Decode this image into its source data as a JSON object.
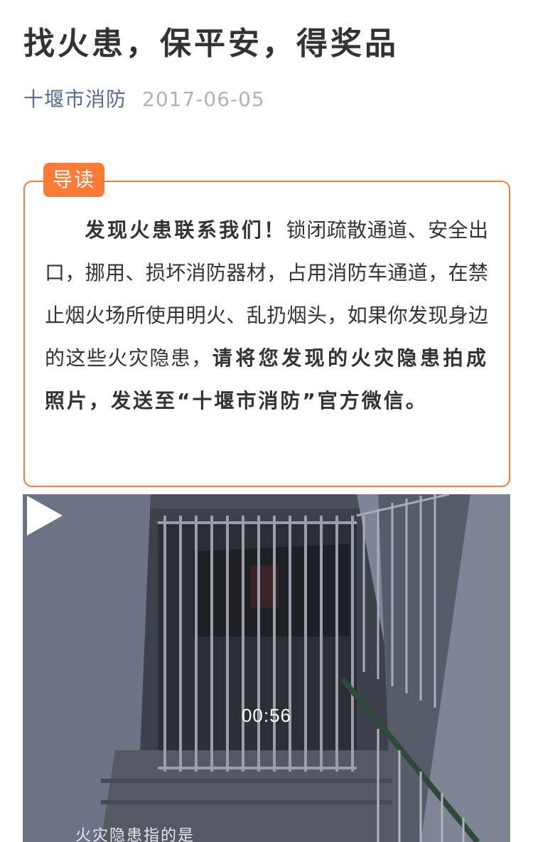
{
  "article": {
    "title": "找火患，保平安，得奖品",
    "account_name": "十堰市消防",
    "publish_date": "2017-06-05"
  },
  "guide": {
    "tag_label": "导读",
    "lead_bold": "发现火患联系我们！",
    "body_text": "锁闭疏散通道、安全出口，挪用、损坏消防器材，占用消防车通道，在禁止烟火场所使用明火、乱扔烟头，如果你发现身边的这些火灾隐患，",
    "closing_bold": "请将您发现的火灾隐患拍成照片，发送至“十堰市消防”官方微信。"
  },
  "video": {
    "duration": "00:56",
    "subtitle_text": "火灾隐患指的是",
    "play_icon": "play-icon"
  },
  "colors": {
    "accent": "#fa7a37",
    "account_link": "#576b95",
    "date_gray": "#b2b2b2",
    "title_text": "#333333"
  }
}
